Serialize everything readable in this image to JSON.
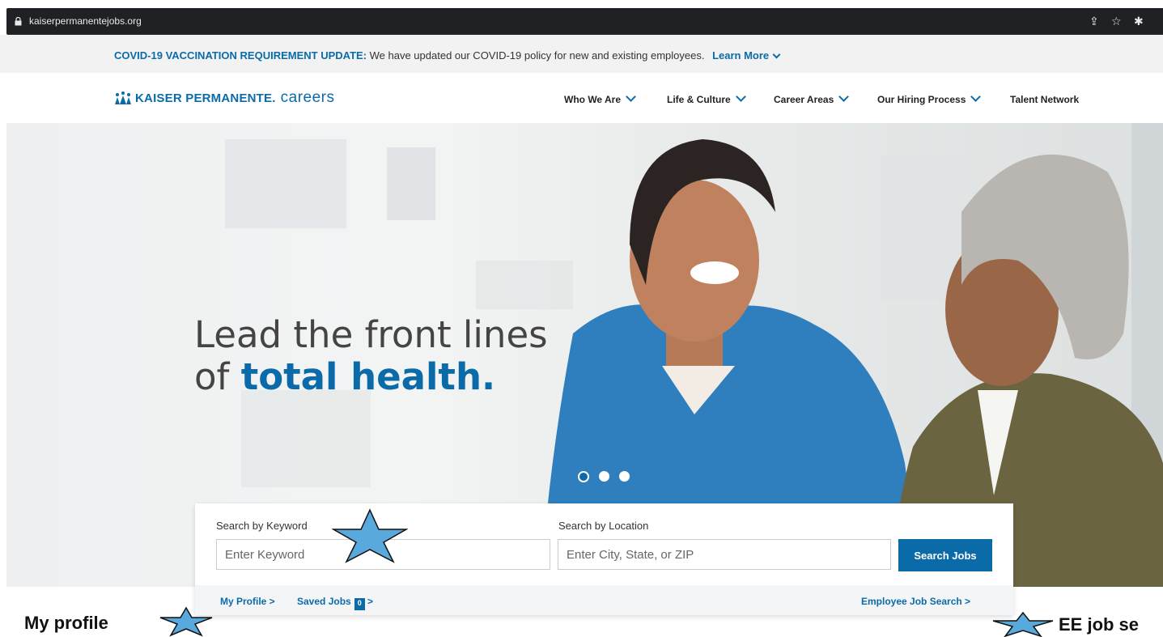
{
  "browser": {
    "url": "kaiserpermanentejobs.org",
    "icons": [
      "share-icon",
      "bookmark-star-icon",
      "extensions-puzzle-icon"
    ]
  },
  "banner": {
    "bold": "COVID-19 VACCINATION REQUIREMENT UPDATE:",
    "text": " We have updated our COVID-19 policy for new and existing employees.",
    "link": "Learn More"
  },
  "nav": {
    "logo_brand": "KAISER PERMANENTE.",
    "logo_suffix": "careers",
    "items": [
      {
        "label": "Who We Are",
        "dropdown": true
      },
      {
        "label": "Life & Culture",
        "dropdown": true
      },
      {
        "label": "Career Areas",
        "dropdown": true
      },
      {
        "label": "Our Hiring Process",
        "dropdown": true
      },
      {
        "label": "Talent Network",
        "dropdown": false
      }
    ]
  },
  "hero": {
    "line1": "Lead the front lines",
    "line2_prefix": "of ",
    "line2_emph": "total health.",
    "carousel": {
      "slides": 3,
      "active": 1
    }
  },
  "search": {
    "keyword_label": "Search by Keyword",
    "keyword_placeholder": "Enter Keyword",
    "location_label": "Search by Location",
    "location_placeholder": "Enter City, State, or ZIP",
    "button": "Search Jobs",
    "my_profile": "My Profile >",
    "saved_jobs": "Saved Jobs",
    "saved_count": "0",
    "saved_arrow": ">",
    "employee_search": "Employee Job Search >"
  },
  "annotations": {
    "my_profile": "My profile",
    "ee_job": "EE job se"
  },
  "colors": {
    "brand": "#0b6ba8",
    "star_fill": "#5aa9dd"
  }
}
